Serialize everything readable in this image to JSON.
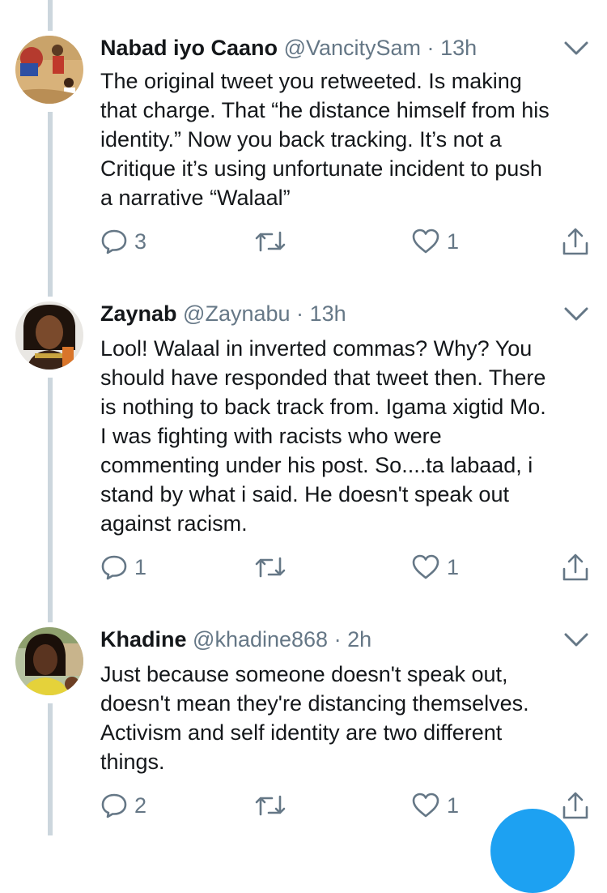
{
  "tweets": [
    {
      "name": "Nabad iyo Caano",
      "handle": "@VancitySam",
      "separator": "·",
      "time": "13h",
      "text": "The original tweet you retweeted. Is making\nthat charge. That “he distance himself from his\nidentity.” Now you back tracking. It’s not a\nCritique it’s using unfortunate incident to push\na narrative “Walaal”",
      "replies": "3",
      "retweets": "",
      "likes": "1"
    },
    {
      "name": "Zaynab",
      "handle": "@Zaynabu",
      "separator": "·",
      "time": "13h",
      "text": "Lool! Walaal in inverted commas? Why? You\nshould have responded that tweet then. There\nis nothing to back track from. Igama xigtid Mo.\nI was fighting with racists who were\ncommenting under his post. So....ta labaad, i\nstand by what i said. He doesn't speak out\nagainst racism.",
      "replies": "1",
      "retweets": "",
      "likes": "1"
    },
    {
      "name": "Khadine",
      "handle": "@khadine868",
      "separator": "·",
      "time": "2h",
      "text": "Just because someone doesn't speak out,\ndoesn't mean they're distancing themselves.\nActivism and self identity are two different\nthings.",
      "replies": "2",
      "retweets": "",
      "likes": "1"
    }
  ],
  "colors": {
    "thread_line": "#ccd6dd",
    "secondary_text": "#657786",
    "primary_text": "#14171a",
    "accent": "#1da1f2"
  },
  "icons": {
    "reply": "reply-icon",
    "retweet": "retweet-icon",
    "like": "heart-icon",
    "share": "share-icon",
    "more": "chevron-down-icon"
  }
}
